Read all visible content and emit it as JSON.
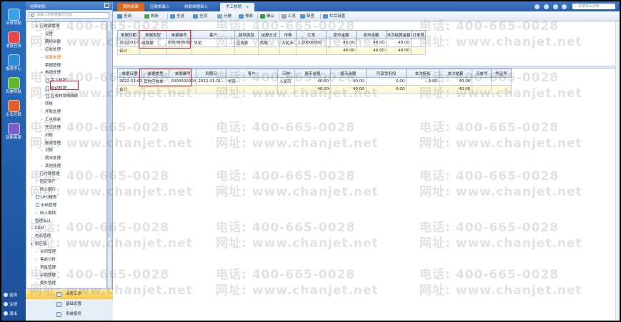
{
  "sidebar": {
    "items": [
      {
        "label": "业务导航",
        "icon": "business-nav-icon",
        "color": "#3aa0e8"
      },
      {
        "label": "消息任务",
        "icon": "message-task-icon",
        "color": "#e24a4a"
      },
      {
        "label": "报表中心",
        "icon": "report-center-icon",
        "color": "#2e8bd6"
      },
      {
        "label": "实施导航",
        "icon": "implement-nav-icon",
        "color": "#5fb830"
      },
      {
        "label": "企业互联",
        "icon": "enterprise-connect-icon",
        "color": "#e05f2a"
      },
      {
        "label": "智能客服",
        "icon": "smart-service-icon",
        "color": "#7a5fc8"
      }
    ],
    "bottom": [
      "选项",
      "注销",
      "退出"
    ]
  },
  "nav": {
    "header": "经典树形",
    "search_placeholder": "请输入您要搜索的功能",
    "tree": [
      {
        "label": "应收款管理",
        "indent": 1,
        "arrow": "▾"
      },
      {
        "label": "设置",
        "indent": 2,
        "arrow": "›"
      },
      {
        "label": "期初余额",
        "indent": 2,
        "arrow": "›"
      },
      {
        "label": "应收处理",
        "indent": 2,
        "arrow": "›"
      },
      {
        "label": "收款处理",
        "indent": 2,
        "arrow": "›",
        "orange": true
      },
      {
        "label": "票据管理",
        "indent": 2,
        "arrow": "›"
      },
      {
        "label": "核销处理",
        "indent": 2,
        "arrow": "▾"
      },
      {
        "label": "手工核销",
        "indent": 3,
        "doc": true
      },
      {
        "label": "自动核销",
        "indent": 3,
        "doc": true
      },
      {
        "label": "应收核销明细表",
        "indent": 3,
        "doc": true
      },
      {
        "label": "转账",
        "indent": 2,
        "arrow": "›"
      },
      {
        "label": "坏账处理",
        "indent": 2,
        "arrow": "›"
      },
      {
        "label": "汇兑损益",
        "indent": 2,
        "arrow": "›"
      },
      {
        "label": "凭证处理",
        "indent": 2,
        "arrow": "›"
      },
      {
        "label": "封账",
        "indent": 2,
        "arrow": "›"
      },
      {
        "label": "账表管理",
        "indent": 2,
        "arrow": "›"
      },
      {
        "label": "对账",
        "indent": 2,
        "arrow": "›"
      },
      {
        "label": "期末处理",
        "indent": 2,
        "arrow": "›"
      },
      {
        "label": "其他处理",
        "indent": 2,
        "arrow": "›"
      },
      {
        "label": "应付款管理",
        "indent": 1,
        "arrow": "›"
      },
      {
        "label": "固定资产",
        "indent": 1,
        "arrow": "›"
      },
      {
        "label": "网上银行",
        "indent": 1,
        "arrow": "›"
      },
      {
        "label": "UFO报表",
        "indent": 1,
        "doc": true
      },
      {
        "label": "出纳管理",
        "indent": 1,
        "doc": true
      },
      {
        "label": "网上报销",
        "indent": 1,
        "arrow": "›"
      },
      {
        "label": "管理会计",
        "indent": 0,
        "arrow": "›"
      },
      {
        "label": "CRM",
        "indent": 0,
        "arrow": "›"
      },
      {
        "label": "电商管理",
        "indent": 0,
        "arrow": "›"
      },
      {
        "label": "供应链",
        "indent": 0,
        "arrow": "▾"
      },
      {
        "label": "合同管理",
        "indent": 1,
        "arrow": "›"
      },
      {
        "label": "售前分析",
        "indent": 1,
        "arrow": "›"
      },
      {
        "label": "销售管理",
        "indent": 1,
        "arrow": "›"
      },
      {
        "label": "采购管理",
        "indent": 1,
        "arrow": "›"
      },
      {
        "label": "委外管理",
        "indent": 1,
        "arrow": "›"
      }
    ],
    "bottom_items": [
      "业务工作",
      "基础设置",
      "系统服务"
    ]
  },
  "tabs": [
    {
      "label": "我的桌面",
      "state": "first"
    },
    {
      "label": "应收单录入",
      "state": "normal"
    },
    {
      "label": "收款单据录入",
      "state": "normal"
    },
    {
      "label": "手工核销",
      "state": "active"
    }
  ],
  "top_right": {
    "search_placeholder": "单据条码搜索"
  },
  "toolbar": [
    "查询",
    "刷新",
    "全选",
    "全消",
    "分摊",
    "预收",
    "确认",
    "汇总",
    "联查",
    "栏目设置"
  ],
  "upper_table": {
    "headers": [
      "单据日期",
      "单据类型",
      "单据编号",
      "客户",
      "款项类型",
      "结算方式",
      "币种",
      "汇率",
      "原币金额",
      "原币余额",
      "本次结算金额",
      "订单号"
    ],
    "rows": [
      [
        "2022-01-01",
        "收款单",
        "0000000009",
        "华润",
        "应收款",
        "转账",
        "人民币",
        "1.00000000",
        "40.00",
        "40.00",
        "40.00",
        ""
      ]
    ],
    "total": [
      "合计",
      "",
      "",
      "",
      "",
      "",
      "",
      "",
      "40.00",
      "40.00",
      "40.00",
      ""
    ]
  },
  "lower_table": {
    "headers": [
      "单据日期",
      "单据类型",
      "单据编号",
      "到期日",
      "客户",
      "币种",
      "原币金额",
      "原币余额",
      "可享受折扣",
      "本次折扣",
      "本次结算",
      "订单号",
      "凭证号"
    ],
    "rows": [
      [
        "2022-01-01",
        "其他应收单",
        "0000000004",
        "2022-01-01",
        "华润",
        "人民币",
        "40.00",
        "40.00",
        "0.00",
        "0.00",
        "40.00",
        "",
        ""
      ]
    ],
    "total": [
      "合计",
      "",
      "",
      "",
      "",
      "",
      "40.00",
      "40.00",
      "0.00",
      "",
      "40.00",
      "",
      ""
    ]
  },
  "watermark": {
    "phone": "电话: 400-665-0028",
    "site": "网址: www.chanjet.net"
  }
}
